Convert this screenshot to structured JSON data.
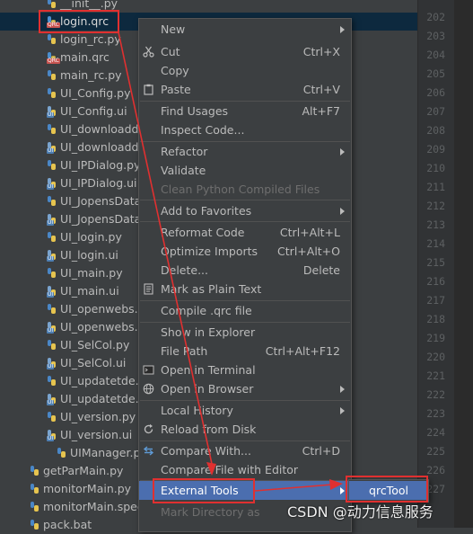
{
  "tree": {
    "files": [
      {
        "name": "__init__.py",
        "type": "py"
      },
      {
        "name": "login.qrc",
        "type": "qrc"
      },
      {
        "name": "login_rc.py",
        "type": "py"
      },
      {
        "name": "main.qrc",
        "type": "qrc"
      },
      {
        "name": "main_rc.py",
        "type": "py"
      },
      {
        "name": "UI_Config.py",
        "type": "py"
      },
      {
        "name": "UI_Config.ui",
        "type": "ui"
      },
      {
        "name": "UI_downloadda",
        "type": "py"
      },
      {
        "name": "UI_downloadda",
        "type": "ui"
      },
      {
        "name": "UI_IPDialog.py",
        "type": "py"
      },
      {
        "name": "UI_IPDialog.ui",
        "type": "ui"
      },
      {
        "name": "UI_JopensData.",
        "type": "py"
      },
      {
        "name": "UI_JopensData.",
        "type": "ui"
      },
      {
        "name": "UI_login.py",
        "type": "py"
      },
      {
        "name": "UI_login.ui",
        "type": "ui"
      },
      {
        "name": "UI_main.py",
        "type": "py"
      },
      {
        "name": "UI_main.ui",
        "type": "ui"
      },
      {
        "name": "UI_openwebs.p",
        "type": "py"
      },
      {
        "name": "UI_openwebs.ui",
        "type": "ui"
      },
      {
        "name": "UI_SelCol.py",
        "type": "py"
      },
      {
        "name": "UI_SelCol.ui",
        "type": "ui"
      },
      {
        "name": "UI_updatetde.p",
        "type": "py"
      },
      {
        "name": "UI_updatetde.u",
        "type": "ui"
      },
      {
        "name": "UI_version.py",
        "type": "py"
      },
      {
        "name": "UI_version.ui",
        "type": "ui"
      },
      {
        "name": "UIManager.py",
        "type": "py"
      },
      {
        "name": "getParMain.py",
        "type": "py"
      },
      {
        "name": "monitorMain.py",
        "type": "py"
      },
      {
        "name": "monitorMain.spec",
        "type": "py"
      },
      {
        "name": "pack.bat",
        "type": "py"
      }
    ]
  },
  "gutter": {
    "line_numbers": [
      "202",
      "203",
      "204",
      "205",
      "206",
      "207",
      "208",
      "209",
      "210",
      "211",
      "212",
      "213",
      "214",
      "215",
      "216",
      "217",
      "218",
      "219",
      "220",
      "221",
      "222",
      "223",
      "224",
      "225",
      "226",
      "227"
    ]
  },
  "context_menu": {
    "items": [
      {
        "label": "New",
        "submenu": true
      },
      {
        "label": "Cut",
        "shortcut": "Ctrl+X",
        "icon": "scissors-icon"
      },
      {
        "label": "Copy",
        "shortcut": ""
      },
      {
        "label": "Paste",
        "shortcut": "Ctrl+V",
        "icon": "clipboard-icon"
      },
      {
        "label": "Find Usages",
        "shortcut": "Alt+F7"
      },
      {
        "label": "Inspect Code..."
      },
      {
        "label": "Refactor",
        "submenu": true
      },
      {
        "label": "Validate"
      },
      {
        "label": "Clean Python Compiled Files",
        "disabled": true
      },
      {
        "label": "Add to Favorites",
        "submenu": true
      },
      {
        "label": "Reformat Code",
        "shortcut": "Ctrl+Alt+L"
      },
      {
        "label": "Optimize Imports",
        "shortcut": "Ctrl+Alt+O"
      },
      {
        "label": "Delete...",
        "shortcut": "Delete"
      },
      {
        "label": "Mark as Plain Text",
        "icon": "plain-text-icon"
      },
      {
        "label": "Compile .qrc file"
      },
      {
        "label": "Show in Explorer"
      },
      {
        "label": "File Path",
        "shortcut": "Ctrl+Alt+F12"
      },
      {
        "label": "Open in Terminal",
        "icon": "terminal-icon"
      },
      {
        "label": "Open in Browser",
        "submenu": true,
        "icon": "globe-icon"
      },
      {
        "label": "Local History",
        "submenu": true
      },
      {
        "label": "Reload from Disk",
        "icon": "reload-icon"
      },
      {
        "label": "Compare With...",
        "shortcut": "Ctrl+D",
        "icon": "compare-icon"
      },
      {
        "label": "Compare File with Editor"
      },
      {
        "label": "External Tools",
        "submenu": true,
        "highlighted": true
      },
      {
        "label": "Mark Directory as",
        "disabled": true
      }
    ]
  },
  "submenu": {
    "items": [
      {
        "label": "qrcTool"
      }
    ]
  },
  "annotation": {
    "color": "#e03030"
  },
  "watermark": {
    "text": "CSDN @动力信息服务"
  },
  "colors": {
    "background": "#3c3f41",
    "selection": "#0d293e",
    "menu_highlight": "#4b6eaf"
  }
}
